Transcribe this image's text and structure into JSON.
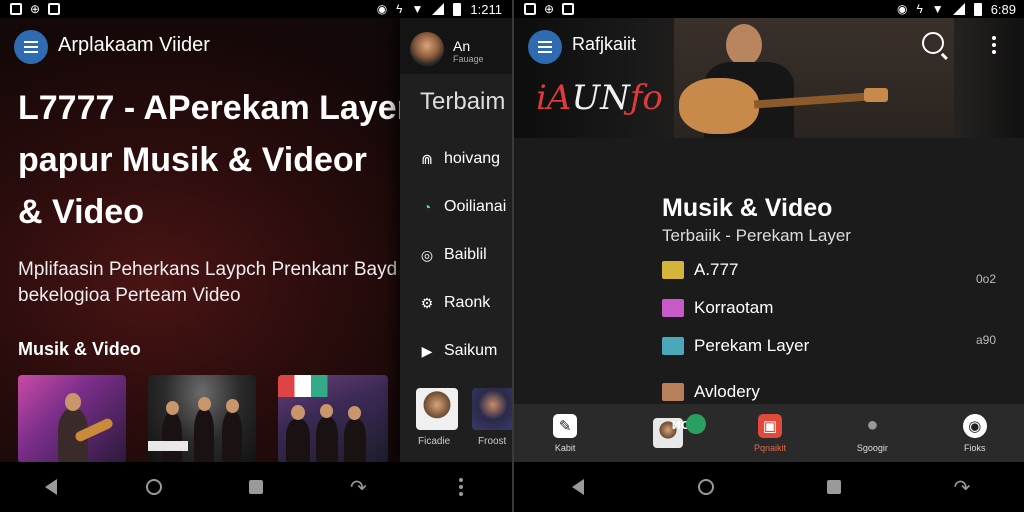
{
  "left": {
    "status": {
      "time": "1:211"
    },
    "app_title": "Arplakaam Viider",
    "headline": "L7777 - APerekam Layer\npapur Musik & Videor\n& Video",
    "description": "Mplifaasin Peherkans Laypch Prenkanr Bayd\nbekelogioa Perteam Video",
    "section_title": "Musik & Video",
    "drawer": {
      "user_name": "An",
      "user_sub": "Fauage",
      "title": "Terbaim",
      "items": [
        {
          "label": "hoivang",
          "icon": "equalizer-icon",
          "glyph": "⋒"
        },
        {
          "label": "Ooilianai",
          "icon": "clock-icon",
          "glyph": "◔"
        },
        {
          "label": "Baiblil",
          "icon": "disc-icon",
          "glyph": "◎"
        },
        {
          "label": "Raonk",
          "icon": "settings-icon",
          "glyph": "⚙"
        },
        {
          "label": "Saikum",
          "icon": "play-icon",
          "glyph": "▶"
        }
      ],
      "cards": [
        {
          "label": "Ficadie"
        },
        {
          "label": "Froost"
        }
      ]
    }
  },
  "right": {
    "status": {
      "time": "6:89"
    },
    "app_title": "Rafjkaiit",
    "logo_text": "iAUNƒo",
    "heading": "Musik & Video",
    "subheading": "Terbaiik - Perekam Layer",
    "rows": [
      {
        "label": "A.777",
        "value": "0o2",
        "color": "#d4b43a"
      },
      {
        "label": "Korraotam",
        "value": "",
        "color": "#c85ac8"
      },
      {
        "label": "Perekam Layer",
        "value": "a90",
        "color": "#4aa8b8"
      },
      {
        "label": "Avlodery",
        "value": "",
        "color": "#b8805a"
      }
    ],
    "tabs": [
      {
        "label": "Kabit",
        "icon": "edit-icon",
        "color": "#ffffff",
        "glyph": "✎"
      },
      {
        "label": "",
        "icon": "avatar-icon",
        "color": "#cccccc",
        "glyph": ""
      },
      {
        "label": "Pqnaikit",
        "icon": "gift-icon",
        "color": "#e04a3a",
        "glyph": "▣"
      },
      {
        "label": "Sgoogir",
        "icon": "profile-icon",
        "color": "#999999",
        "glyph": "●"
      },
      {
        "label": "Fioks",
        "icon": "camera-icon",
        "color": "#ffffff",
        "glyph": "◉"
      }
    ],
    "tab_badge": "ᴎᴏC"
  }
}
